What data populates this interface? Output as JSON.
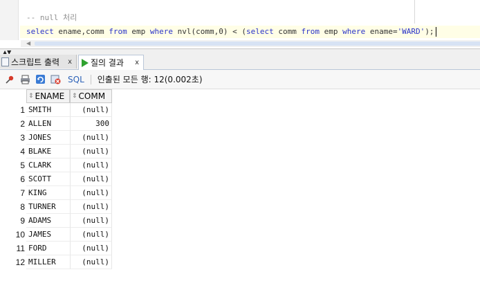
{
  "editor": {
    "comment": "-- null 처리",
    "sql_kw_select": "select",
    "sql_cols": " ename,comm ",
    "sql_kw_from": "from",
    "sql_t1": " emp ",
    "sql_kw_where": "where",
    "sql_cond": " nvl(comm,0) < (",
    "sql_kw_select2": "select",
    "sql_t2": " comm ",
    "sql_kw_from2": "from",
    "sql_t3": " emp ",
    "sql_kw_where2": "where",
    "sql_t4": " ename=",
    "sql_str": "'WARD'",
    "sql_end": ");"
  },
  "tabs": [
    {
      "label": "스크립트 출력",
      "close": "x"
    },
    {
      "label": "질의 결과",
      "close": "x"
    }
  ],
  "toolbar": {
    "sql_label": "SQL",
    "status": "인출된 모든 행: 12(0.002초)"
  },
  "grid": {
    "columns": [
      "ENAME",
      "COMM"
    ],
    "rows": [
      {
        "n": "1",
        "ename": "SMITH",
        "comm": "(null)"
      },
      {
        "n": "2",
        "ename": "ALLEN",
        "comm": "300"
      },
      {
        "n": "3",
        "ename": "JONES",
        "comm": "(null)"
      },
      {
        "n": "4",
        "ename": "BLAKE",
        "comm": "(null)"
      },
      {
        "n": "5",
        "ename": "CLARK",
        "comm": "(null)"
      },
      {
        "n": "6",
        "ename": "SCOTT",
        "comm": "(null)"
      },
      {
        "n": "7",
        "ename": "KING",
        "comm": "(null)"
      },
      {
        "n": "8",
        "ename": "TURNER",
        "comm": "(null)"
      },
      {
        "n": "9",
        "ename": "ADAMS",
        "comm": "(null)"
      },
      {
        "n": "10",
        "ename": "JAMES",
        "comm": "(null)"
      },
      {
        "n": "11",
        "ename": "FORD",
        "comm": "(null)"
      },
      {
        "n": "12",
        "ename": "MILLER",
        "comm": "(null)"
      }
    ]
  },
  "colors": {
    "keyword": "#2a33c9",
    "accent": "#2d62b8",
    "run_icon": "#2fa22f"
  }
}
